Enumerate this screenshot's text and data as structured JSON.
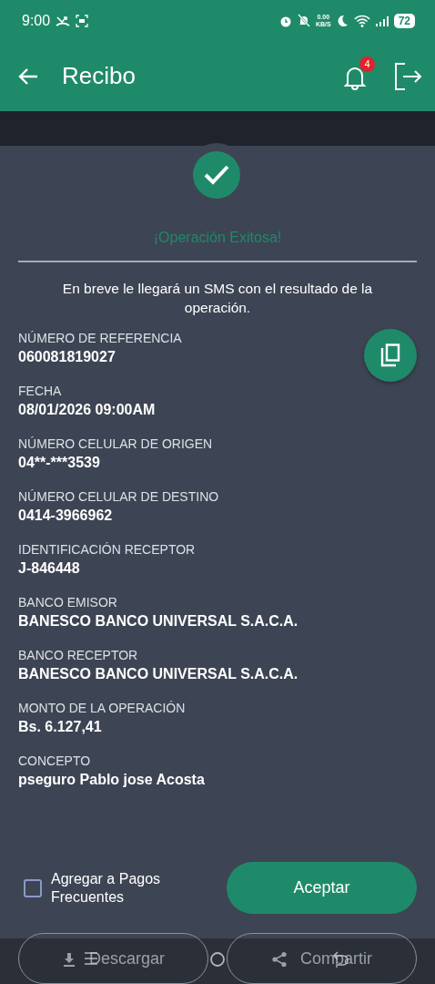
{
  "status_bar": {
    "time": "9:00",
    "net_speed_value": "0.00",
    "net_speed_unit": "KB/S",
    "battery": "72"
  },
  "header": {
    "title": "Recibo",
    "notification_count": "4"
  },
  "result": {
    "title": "¡Operación Exitosa!",
    "message": "En breve le llegará un SMS con el resultado de la operación."
  },
  "fields": [
    {
      "label": "NÚMERO DE REFERENCIA",
      "value": "060081819027",
      "copyable": true
    },
    {
      "label": "FECHA",
      "value": "08/01/2026 09:00AM",
      "copyable": false
    },
    {
      "label": "NÚMERO CELULAR DE ORIGEN",
      "value": "04**-***3539",
      "copyable": false
    },
    {
      "label": "NÚMERO CELULAR DE DESTINO",
      "value": "0414-3966962",
      "copyable": false
    },
    {
      "label": "IDENTIFICACIÓN RECEPTOR",
      "value": "J-846448",
      "copyable": false
    },
    {
      "label": "BANCO EMISOR",
      "value": "BANESCO BANCO UNIVERSAL S.A.C.A.",
      "copyable": false
    },
    {
      "label": "BANCO RECEPTOR",
      "value": "BANESCO BANCO UNIVERSAL S.A.C.A.",
      "copyable": false
    },
    {
      "label": "MONTO DE LA OPERACIÓN",
      "value": "Bs. 6.127,41",
      "copyable": false
    },
    {
      "label": "CONCEPTO",
      "value": "pseguro Pablo jose Acosta",
      "copyable": false
    }
  ],
  "frequent_checkbox": {
    "label": "Agregar a Pagos Frecuentes",
    "checked": false
  },
  "accept_button": "Aceptar",
  "bottom_actions": [
    {
      "label": "Descargar",
      "kind": "download"
    },
    {
      "label": "Compartir",
      "kind": "share"
    }
  ]
}
